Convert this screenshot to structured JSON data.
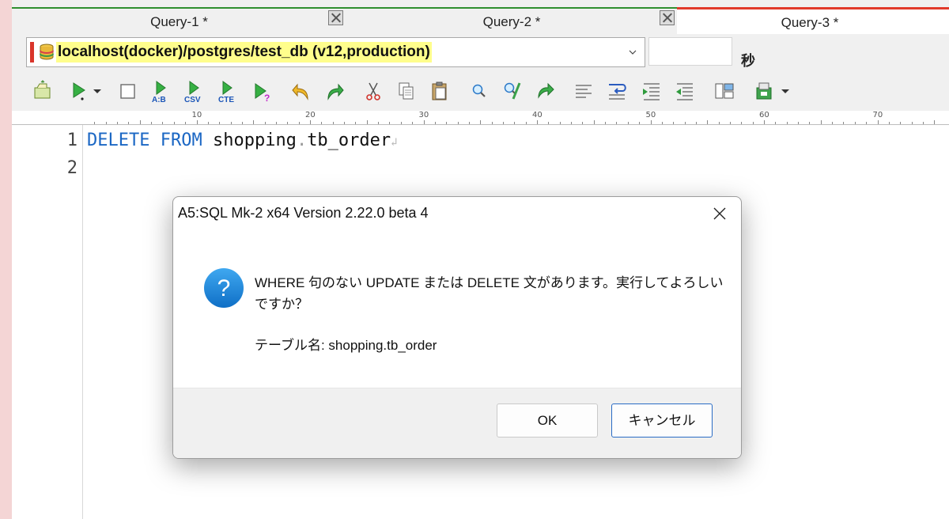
{
  "tabs": [
    {
      "label": "Query-1 *",
      "active": false
    },
    {
      "label": "Query-2 *",
      "active": false
    },
    {
      "label": "Query-3 *",
      "active": true
    }
  ],
  "connection": {
    "value": "localhost(docker)/postgres/test_db (v12,production)",
    "highlight_color": "#fffe8c",
    "indicator_color": "#d9352b"
  },
  "timer": {
    "value": "",
    "unit": "秒"
  },
  "toolbar_icons": [
    "open-file-icon",
    "execute-icon",
    "stop-icon",
    "execute-compare-icon",
    "execute-csv-icon",
    "execute-cte-icon",
    "explain-icon",
    "undo-icon",
    "redo-icon",
    "cut-icon",
    "copy-icon",
    "paste-icon",
    "find-icon",
    "find-replace-icon",
    "jump-icon",
    "format-icon",
    "wrap-icon",
    "indent-icon",
    "outdent-icon",
    "layout-icon",
    "tools-icon"
  ],
  "ruler": {
    "marks": [
      "10",
      "20",
      "30",
      "40",
      "50",
      "60",
      "70"
    ]
  },
  "editor": {
    "line_numbers": [
      "1",
      "2"
    ],
    "keyword1": "DELETE",
    "keyword2": "FROM",
    "schema": "shopping",
    "separator": ".",
    "table": "tb_order",
    "eol_mark": "↲"
  },
  "dialog": {
    "title": "A5:SQL Mk-2 x64 Version 2.22.0 beta 4",
    "message_line1": "WHERE 句のない UPDATE または DELETE 文があります。実行してよろしい",
    "message_line2": "ですか？",
    "table_line": "テーブル名: shopping.tb_order",
    "ok_label": "OK",
    "cancel_label": "キャンセル"
  },
  "colors": {
    "keyword": "#1b67c4",
    "active_tab_border": "#e13a2a",
    "tab_border": "#2f8f2f",
    "question_icon": "#1a86d8"
  }
}
